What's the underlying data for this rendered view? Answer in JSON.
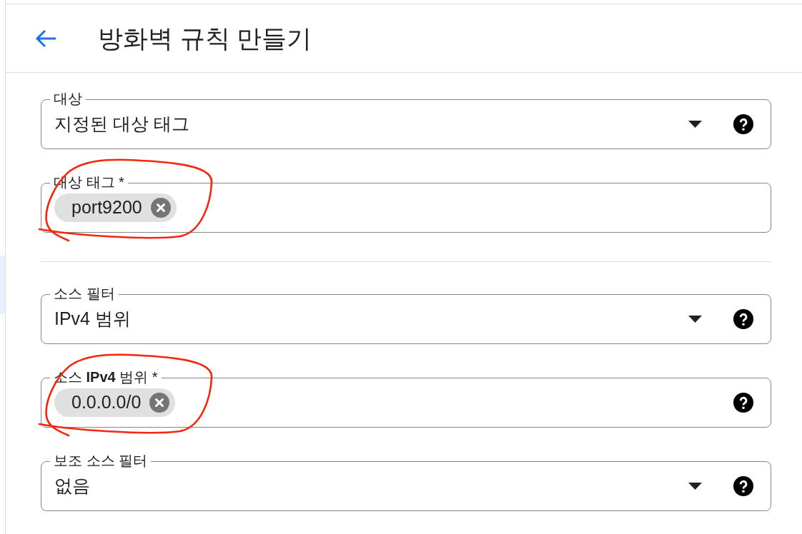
{
  "header": {
    "title": "방화벽 규칙 만들기"
  },
  "sections": [
    {
      "fields": [
        {
          "kind": "select",
          "label": "대상",
          "value": "지정된 대상 태그",
          "help": true,
          "circled": false
        },
        {
          "kind": "chips",
          "label": "대상 태그 *",
          "chips": [
            "port9200"
          ],
          "help": false,
          "circled": true
        }
      ]
    },
    {
      "fields": [
        {
          "kind": "select",
          "label": "소스 필터",
          "value": "IPv4 범위",
          "help": true,
          "circled": false
        },
        {
          "kind": "chips",
          "label": "소스 **IPv4** 범위 *",
          "chips": [
            "0.0.0.0/0"
          ],
          "help": true,
          "circled": true
        },
        {
          "kind": "select",
          "label": "보조 소스 필터",
          "value": "없음",
          "help": true,
          "circled": false
        }
      ]
    }
  ]
}
